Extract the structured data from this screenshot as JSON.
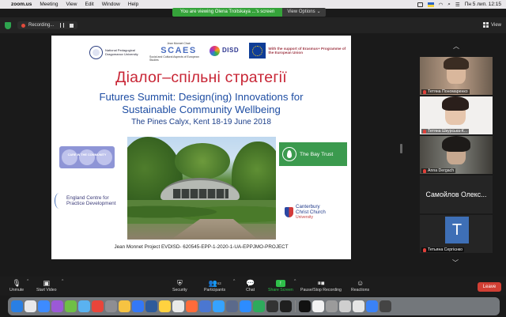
{
  "menubar": {
    "app_name": "zoom.us",
    "items": [
      "Meeting",
      "View",
      "Edit",
      "Window",
      "Help"
    ],
    "datetime": "Пн 5 лип. 12:15"
  },
  "share_banner": {
    "message": "You are viewing Olena Troitskaya ...'s screen",
    "options_label": "View Options"
  },
  "zoom_top": {
    "recording_label": "Recording...",
    "view_label": "View"
  },
  "slide": {
    "logos": {
      "npu": "National Pedagogical Dragomanov University",
      "scaes_top": "Jean Monnet Chair",
      "scaes_big": "SCAES",
      "scaes_bottom": "Social and Cultural Aspects of European Studies",
      "disd": "DISD",
      "eu": "With the support of Erasmus+ Programme of the European Union"
    },
    "title": "Діалог–спільні стратегії",
    "summit_line1": "Futures Summit: Design(ing) Innovations for",
    "summit_line2": "Sustainable Community Wellbeing",
    "venue": "The Pines Calyx, Kent 18-19 June 2018",
    "bay_trust": "The Bay Trust",
    "nhs_label": "CARE IN THE COMMUNITY",
    "ecpd_line1": "England Centre for",
    "ecpd_line2": "Practice Development",
    "ccc_line1": "Canterbury",
    "ccc_line2": "Christ Church",
    "ccc_line3": "University",
    "footer": "Jean Monnet Project EVDISD-  620545-EPP-1-2020-1-UA-EPPJMO-PROJECT"
  },
  "gallery": {
    "participants": [
      {
        "name": "Тетяна Пономаренко"
      },
      {
        "name": "Тетяна Шкурська-К..."
      },
      {
        "name": "Anna Dergach"
      },
      {
        "name": "Самойлов Олекс..."
      },
      {
        "name": "Тетьяна Сергієнко",
        "initial": "T"
      }
    ]
  },
  "toolbar": {
    "unmute": "Unmute",
    "start_video": "Start Video",
    "security": "Security",
    "participants": "Participants",
    "participants_count": "63",
    "chat": "Chat",
    "share_screen": "Share Screen",
    "pause_recording": "Pause/Stop Recording",
    "reactions": "Reactions",
    "leave": "Leave"
  },
  "dock_colors": [
    "#2a7fe3",
    "#e8e8ea",
    "#3d8bff",
    "#9b59d6",
    "#6fbf45",
    "#5ab2f0",
    "#e9453a",
    "#8e8e93",
    "#f6c342",
    "#3478f6",
    "#2e5b9a",
    "#ffd23f",
    "#e9e9e9",
    "#ff6b3a",
    "#4b77d1",
    "#36a3ff",
    "#5b6a8b",
    "#2d8cff",
    "#2eaa5c",
    "#333333",
    "#1f1f1f",
    "#111111",
    "#f2f2f2",
    "#9b9b9b",
    "#cfcfcf",
    "#e5e5e5",
    "#3b82f6",
    "#444444"
  ]
}
